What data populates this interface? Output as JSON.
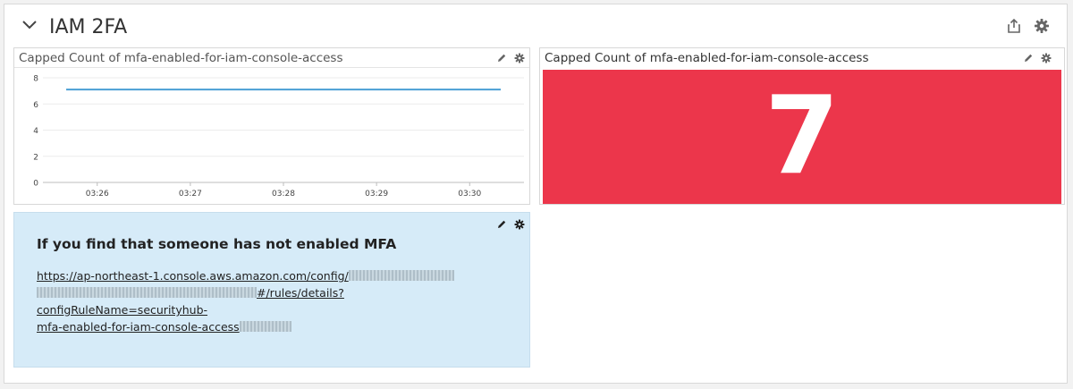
{
  "group": {
    "title": "IAM 2FA",
    "icons": [
      "chevron-down-icon",
      "share-icon",
      "gear-icon"
    ]
  },
  "timeseries_widget": {
    "title": "Capped Count of mfa-enabled-for-iam-console-access",
    "icons": [
      "pencil-icon",
      "gear-icon"
    ]
  },
  "query_value_widget": {
    "title": "Capped Count of mfa-enabled-for-iam-console-access",
    "value": "7",
    "background_color": "#ec364b",
    "icons": [
      "pencil-icon",
      "gear-icon"
    ]
  },
  "note_widget": {
    "heading": "If you find that someone has not enabled MFA",
    "link_part1": "https://ap-northeast-1.console.aws.amazon.com/config/",
    "link_part2": "#/rules/details?configRuleName=securityhub-",
    "link_part3": "mfa-enabled-for-iam-console-access",
    "background_color": "#d6ebf8",
    "icons": [
      "pencil-icon",
      "gear-icon"
    ]
  },
  "chart_data": {
    "type": "line",
    "x": [
      "03:25:40",
      "03:30:20"
    ],
    "x_ticks": [
      "03:26",
      "03:27",
      "03:28",
      "03:29",
      "03:30"
    ],
    "y_ticks": [
      "0",
      "2",
      "4",
      "6",
      "8"
    ],
    "ylim": [
      0,
      8
    ],
    "series": [
      {
        "values": [
          7.1,
          7.1
        ],
        "color": "#4a9fd5"
      }
    ],
    "grid": true
  }
}
